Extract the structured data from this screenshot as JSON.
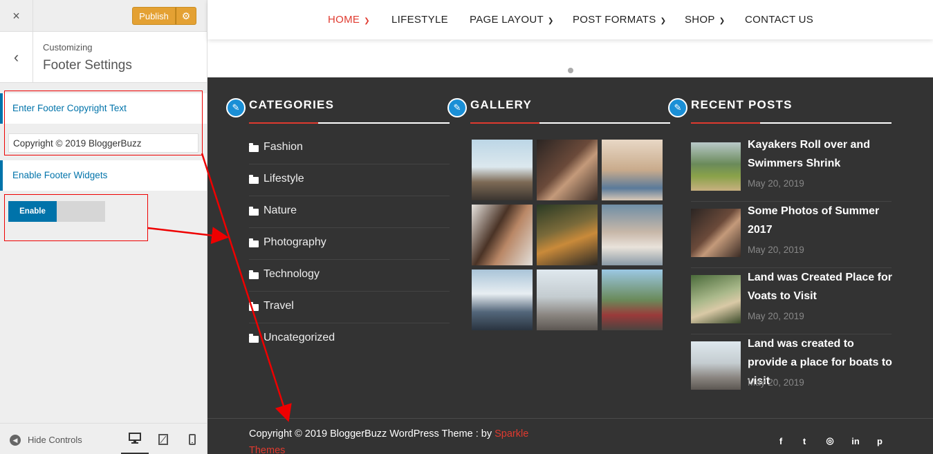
{
  "sidebar": {
    "close_icon": "×",
    "publish_label": "Publish",
    "gear_icon": "⚙",
    "back_icon": "‹",
    "customizing_label": "Customizing",
    "panel_title": "Footer Settings",
    "copyright_section_label": "Enter Footer Copyright Text",
    "copyright_value": "Copyright © 2019 BloggerBuzz",
    "widgets_section_label": "Enable Footer Widgets",
    "toggle_label": "Enable",
    "hide_controls_label": "Hide Controls",
    "devices": [
      "desktop-icon",
      "tablet-icon",
      "mobile-icon"
    ],
    "accent_color": "#0073aa",
    "publish_color": "#e4a133"
  },
  "nav": {
    "items": [
      {
        "label": "HOME",
        "dropdown": true,
        "active": true
      },
      {
        "label": "LIFESTYLE",
        "dropdown": false
      },
      {
        "label": "PAGE LAYOUT",
        "dropdown": true
      },
      {
        "label": "POST FORMATS",
        "dropdown": true
      },
      {
        "label": "SHOP",
        "dropdown": true
      },
      {
        "label": "CONTACT US",
        "dropdown": false
      }
    ],
    "active_color": "#e03a2f"
  },
  "footer": {
    "categories_title": "CATEGORIES",
    "categories": [
      "Fashion",
      "Lifestyle",
      "Nature",
      "Photography",
      "Technology",
      "Travel",
      "Uncategorized"
    ],
    "gallery_title": "GALLERY",
    "recent_title": "RECENT POSTS",
    "recent_posts": [
      {
        "title": "Kayakers Roll over and Swimmers Shrink",
        "date": "May 20, 2019"
      },
      {
        "title": "Some Photos of Summer 2017",
        "date": "May 20, 2019"
      },
      {
        "title": "Land was Created Place for Voats to Visit",
        "date": "May 20, 2019"
      },
      {
        "title": "Land was created to provide a place for boats to visit",
        "date": "May 20, 2019"
      }
    ],
    "copyright_text": "Copyright © 2019 BloggerBuzz WordPress Theme : by ",
    "copyright_link": "Sparkle Themes",
    "social_icons": [
      "facebook-icon",
      "twitter-icon",
      "instagram-icon",
      "linkedin-icon",
      "pinterest-icon"
    ],
    "social_glyphs": [
      "f",
      "t",
      "◎",
      "in",
      "p"
    ],
    "background": "#333333",
    "accent_color": "#e03a2f"
  }
}
